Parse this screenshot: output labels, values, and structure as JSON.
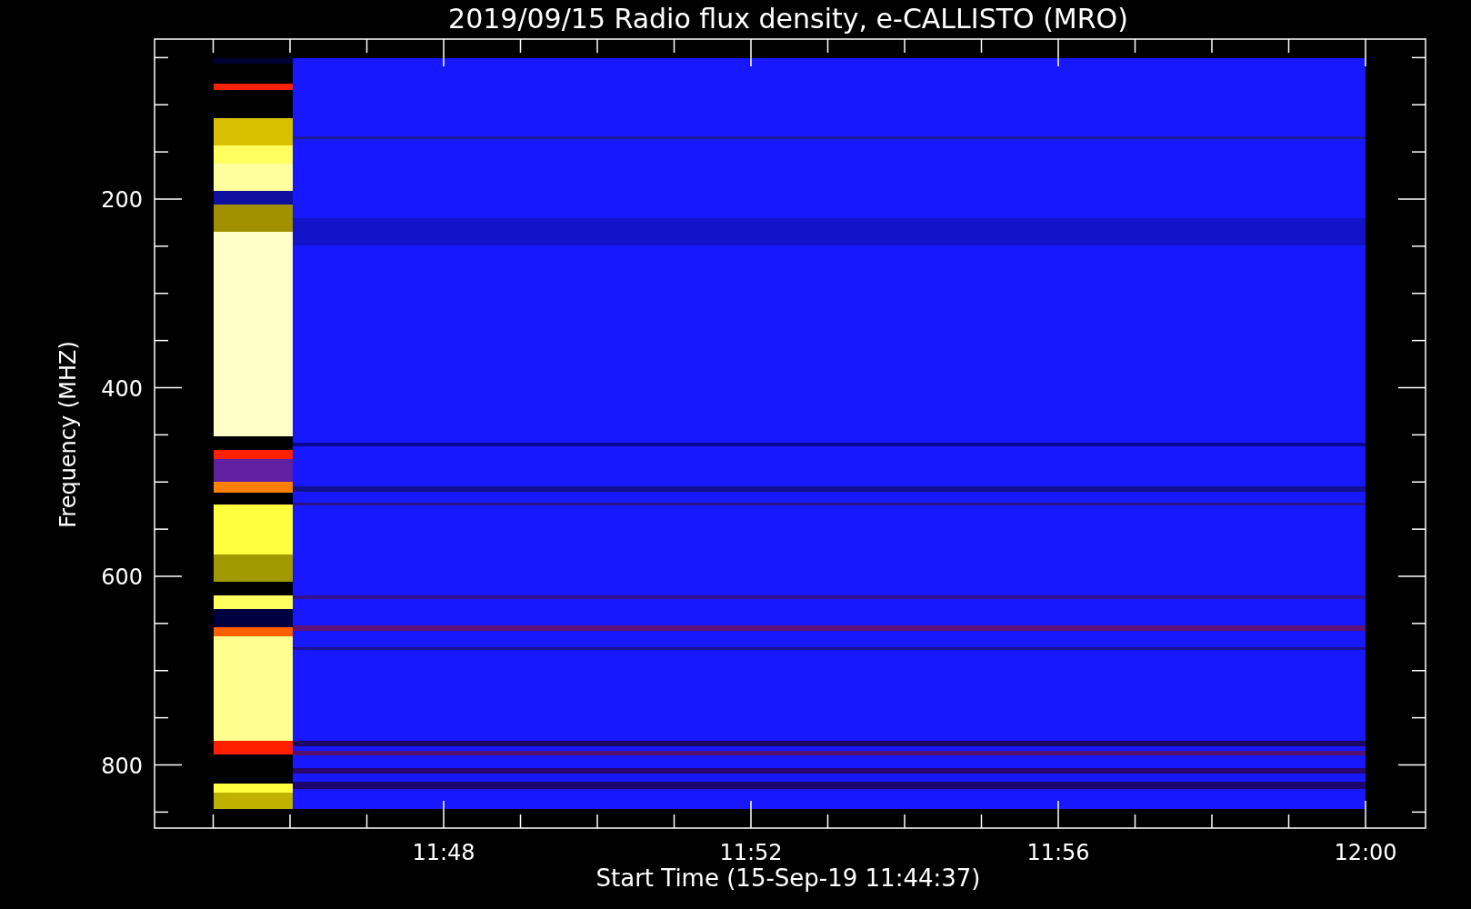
{
  "plot": {
    "title": "2019/09/15  Radio flux density, e-CALLISTO (MRO)",
    "ylabel": "Frequency (MHZ)",
    "xlabel": "Start Time (15-Sep-19 11:44:37)",
    "y_tick_labels": [
      "200",
      "400",
      "600",
      "800"
    ],
    "x_tick_labels": [
      "11:48",
      "11:52",
      "11:56",
      "12:00"
    ]
  }
}
